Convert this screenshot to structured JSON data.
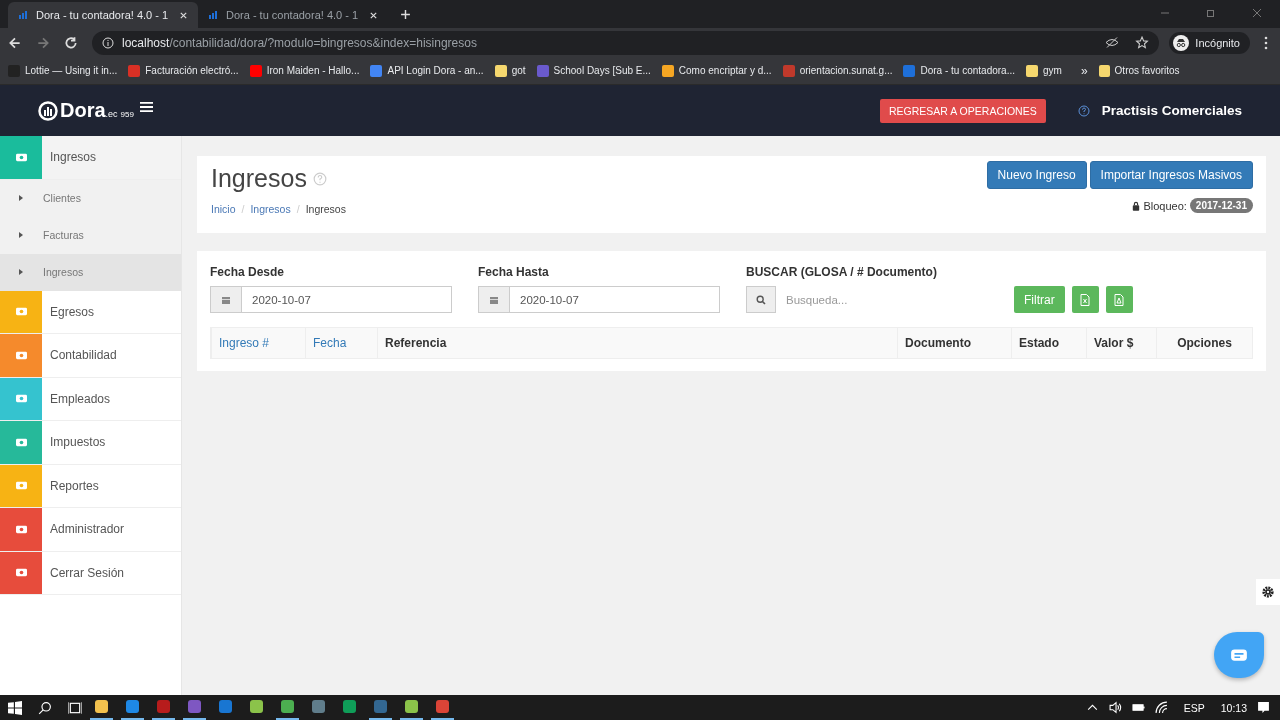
{
  "browser": {
    "tabs": [
      {
        "title": "Dora - tu contadora! 4.0 - 1",
        "selected": true
      },
      {
        "title": "Dora - tu contadora! 4.0 - 1",
        "selected": false
      }
    ],
    "url_host": "localhost",
    "url_path": "/contabilidad/dora/?modulo=bingresos&index=hisingresos",
    "profile": "Incógnito",
    "bookmarks": [
      {
        "label": "Lottie — Using it in...",
        "color": "#222222"
      },
      {
        "label": "Facturación electró...",
        "color": "#d93025"
      },
      {
        "label": "Iron Maiden - Hallo...",
        "color": "#ff0000"
      },
      {
        "label": "API Login Dora - an...",
        "color": "#4285f4"
      },
      {
        "label": "got",
        "color": "#f5d76e"
      },
      {
        "label": "School Days [Sub E...",
        "color": "#6a5acd"
      },
      {
        "label": "Como encriptar y d...",
        "color": "#f5a623"
      },
      {
        "label": "orientacion.sunat.g...",
        "color": "#c0392b"
      },
      {
        "label": "Dora - tu contadora...",
        "color": "#1e6fd9"
      },
      {
        "label": "gym",
        "color": "#f5d76e"
      }
    ],
    "more": "»",
    "other": "Otros favoritos"
  },
  "header": {
    "brand": "Dora",
    "brand_suffix": ".ec",
    "version": "959",
    "back_button": "REGRESAR A OPERACIONES",
    "company": "Practisis Comerciales"
  },
  "sidebar": [
    {
      "label": "Ingresos",
      "color": "#1abc9c",
      "expanded": true,
      "children": [
        {
          "label": "Clientes",
          "selected": false
        },
        {
          "label": "Facturas",
          "selected": false
        },
        {
          "label": "Ingresos",
          "selected": true
        }
      ]
    },
    {
      "label": "Egresos",
      "color": "#f7b314",
      "expanded": false
    },
    {
      "label": "Contabilidad",
      "color": "#f58a2c",
      "expanded": false
    },
    {
      "label": "Empleados",
      "color": "#35c3cf",
      "expanded": false
    },
    {
      "label": "Impuestos",
      "color": "#26b99a",
      "expanded": false
    },
    {
      "label": "Reportes",
      "color": "#f7b314",
      "expanded": false
    },
    {
      "label": "Administrador",
      "color": "#e74c3c",
      "expanded": false
    },
    {
      "label": "Cerrar Sesión",
      "color": "#e74c3c",
      "expanded": false
    }
  ],
  "page": {
    "title": "Ingresos",
    "breadcrumb": [
      "Inicio",
      "Ingresos",
      "Ingresos"
    ],
    "breadcrumb_separator": "/",
    "buttons": [
      "Nuevo Ingreso",
      "Importar Ingresos Masivos"
    ],
    "lock_label": "Bloqueo:",
    "lock_date": "2017-12-31"
  },
  "filters": {
    "from_label": "Fecha Desde",
    "from_value": "2020-10-07",
    "to_label": "Fecha Hasta",
    "to_value": "2020-10-07",
    "search_label": "BUSCAR (GLOSA / # Documento)",
    "search_placeholder": "Busqueda...",
    "filter_button": "Filtrar"
  },
  "table": {
    "columns": [
      {
        "label": "Ingreso #",
        "sortable": true
      },
      {
        "label": "Fecha",
        "sortable": true
      },
      {
        "label": "Referencia",
        "sortable": false
      },
      {
        "label": "Documento",
        "sortable": false
      },
      {
        "label": "Estado",
        "sortable": false
      },
      {
        "label": "Valor $",
        "sortable": false
      },
      {
        "label": "Opciones",
        "sortable": false
      }
    ]
  },
  "taskbar": {
    "apps": [
      {
        "color": "#f2c14e",
        "running": true
      },
      {
        "color": "#1e88e5",
        "running": true
      },
      {
        "color": "#b71c1c",
        "running": true
      },
      {
        "color": "#7e57c2",
        "running": true
      },
      {
        "color": "#1976d2",
        "running": false
      },
      {
        "color": "#8bc34a",
        "running": false
      },
      {
        "color": "#4caf50",
        "running": true
      },
      {
        "color": "#607d8b",
        "running": false
      },
      {
        "color": "#0f9d58",
        "running": false
      },
      {
        "color": "#336791",
        "running": true
      },
      {
        "color": "#8bc34a",
        "running": true
      },
      {
        "color": "#db4437",
        "running": true
      }
    ],
    "language": "ESP",
    "time": "10:13"
  }
}
